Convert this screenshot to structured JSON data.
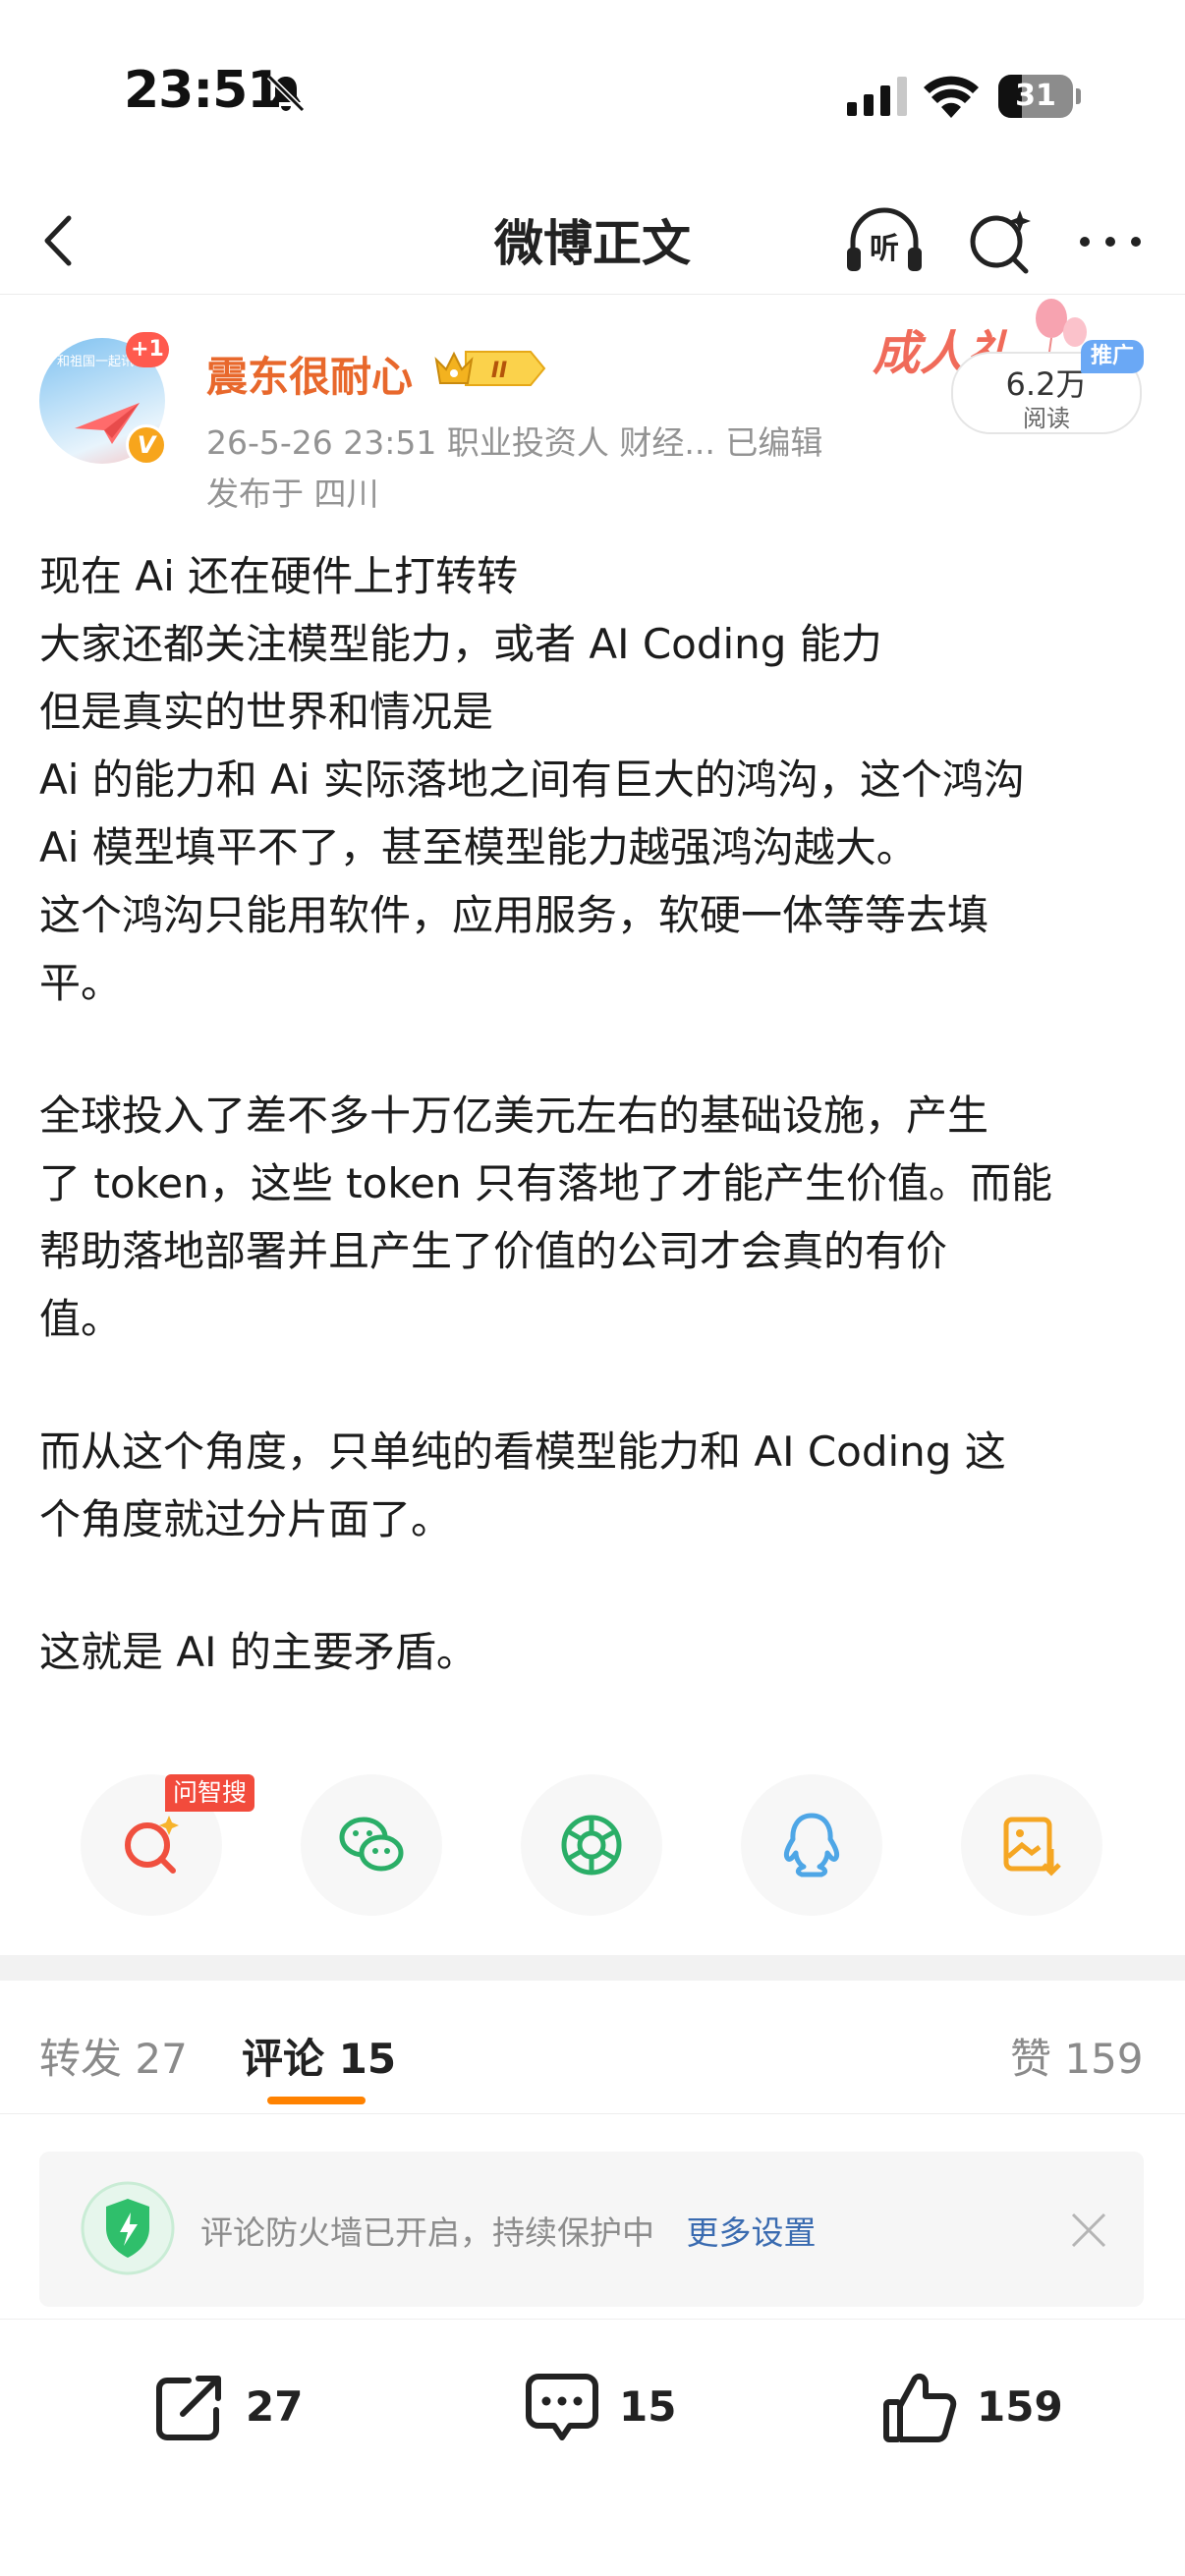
{
  "status_bar": {
    "time": "23:51",
    "battery": "31"
  },
  "nav": {
    "title": "微博正文",
    "listen_label": "听"
  },
  "author": {
    "name": "震东很耐心",
    "level_badge": "II",
    "avatar_badge": "+1",
    "avatar_caption": "和祖国一起讯飞",
    "verified_mark": "V",
    "meta": "26-5-26 23:51  职业投资人 财经...  已编辑",
    "location": "发布于 四川"
  },
  "promo": {
    "art_text": "成人礼",
    "read_count": "6.2万",
    "read_label": "阅读",
    "tag": "推广"
  },
  "post": {
    "paragraphs": [
      [
        "现在 Ai 还在硬件上打转转",
        "大家还都关注模型能力，或者 AI Coding 能力",
        "但是真实的世界和情况是",
        "Ai 的能力和 Ai 实际落地之间有巨大的鸿沟，这个鸿沟",
        " Ai 模型填平不了，甚至模型能力越强鸿沟越大。",
        "这个鸿沟只能用软件，应用服务，软硬一体等等去填",
        "平。"
      ],
      [
        "全球投入了差不多十万亿美元左右的基础设施，产生",
        "了 token，这些 token 只有落地了才能产生价值。而能",
        "帮助落地部署并且产生了价值的公司才会真的有价",
        "值。"
      ],
      [
        "而从这个角度，只单纯的看模型能力和 AI Coding 这",
        "个角度就过分片面了。"
      ],
      [
        "这就是 AI 的主要矛盾。"
      ]
    ]
  },
  "share": {
    "search_tag": "问智搜"
  },
  "tabs": {
    "repost": "转发 27",
    "comments": "评论 15",
    "likes": "赞 159"
  },
  "notice": {
    "text": "评论防火墙已开启，持续保护中",
    "link": "更多设置"
  },
  "bottom_bar": {
    "repost_count": "27",
    "comment_count": "15",
    "like_count": "159"
  },
  "colors": {
    "accent": "#ff8200",
    "name": "#e8682c",
    "link": "#3a6bb0",
    "wechat": "#2aae67",
    "qq": "#4ea6e6"
  }
}
